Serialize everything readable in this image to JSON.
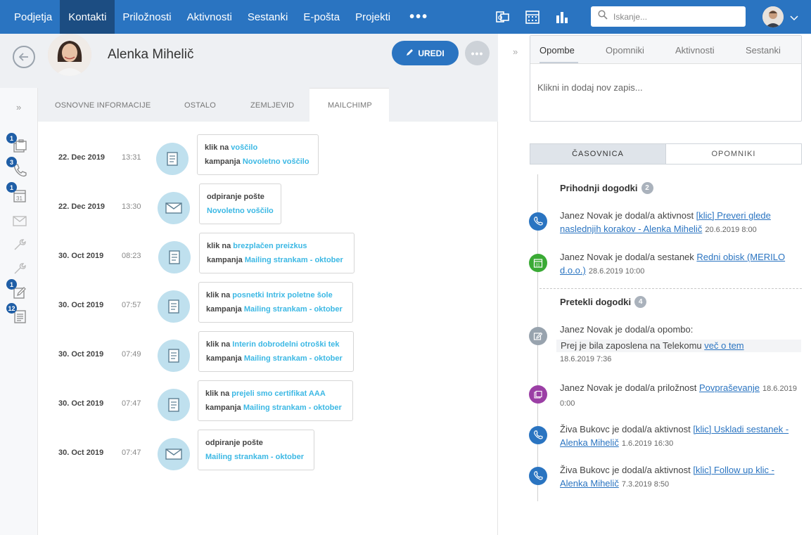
{
  "nav": {
    "items": [
      "Podjetja",
      "Kontakti",
      "Priložnosti",
      "Aktivnosti",
      "Sestanki",
      "E-pošta",
      "Projekti"
    ],
    "more": "•••",
    "search_placeholder": "Iskanje..."
  },
  "contact": {
    "name": "Alenka Mihelič",
    "edit_label": "UREDI",
    "more": "•••"
  },
  "tabs": [
    "OSNOVNE INFORMACIJE",
    "OSTALO",
    "ZEMLJEVID",
    "MAILCHIMP"
  ],
  "rail_badges": [
    "1",
    "3",
    "1",
    "1",
    "12"
  ],
  "activities": [
    {
      "date": "22. Dec 2019",
      "time": "13:31",
      "icon": "document-icon",
      "line1_label": "klik na",
      "line1_link": "voščilo",
      "line2_label": "kampanja",
      "line2_link": "Novoletno voščilo"
    },
    {
      "date": "22. Dec 2019",
      "time": "13:30",
      "icon": "envelope-icon",
      "line1_label": "odpiranje pošte",
      "line1_link": "",
      "line2_label": "",
      "line2_link": "Novoletno voščilo"
    },
    {
      "date": "30. Oct 2019",
      "time": "08:23",
      "icon": "document-icon",
      "line1_label": "klik na",
      "line1_link": "brezplačen preizkus",
      "line2_label": "kampanja",
      "line2_link": "Mailing strankam - oktober"
    },
    {
      "date": "30. Oct 2019",
      "time": "07:57",
      "icon": "document-icon",
      "line1_label": "klik na",
      "line1_link": "posnetki Intrix poletne šole",
      "line2_label": "kampanja",
      "line2_link": "Mailing strankam - oktober"
    },
    {
      "date": "30. Oct 2019",
      "time": "07:49",
      "icon": "document-icon",
      "line1_label": "klik na",
      "line1_link": "Interin dobrodelni otroški tek",
      "line2_label": "kampanja",
      "line2_link": "Mailing strankam - oktober"
    },
    {
      "date": "30. Oct 2019",
      "time": "07:47",
      "icon": "document-icon",
      "line1_label": "klik na",
      "line1_link": "prejeli smo certifikat AAA",
      "line2_label": "kampanja",
      "line2_link": "Mailing strankam - oktober"
    },
    {
      "date": "30. Oct 2019",
      "time": "07:47",
      "icon": "envelope-icon",
      "line1_label": "odpiranje pošte",
      "line1_link": "",
      "line2_label": "",
      "line2_link": "Mailing strankam - oktober"
    }
  ],
  "notes": {
    "tabs": [
      "Opombe",
      "Opomniki",
      "Aktivnosti",
      "Sestanki"
    ],
    "placeholder": "Klikni in dodaj nov zapis..."
  },
  "segments": [
    "ČASOVNICA",
    "OPOMNIKI"
  ],
  "timeline": {
    "upcoming_title": "Prihodnji dogodki",
    "upcoming_count": "2",
    "past_title": "Pretekli dogodki",
    "past_count": "4",
    "events": [
      {
        "icon": "phone-icon",
        "color": "#2a74c1",
        "prefix": "Janez Novak je dodal/a aktivnost ",
        "link": "[klic] Preveri glede naslednjih korakov - Alenka Mihelič",
        "date": "20.6.2019 8:00"
      },
      {
        "icon": "calendar-icon",
        "color": "#3aaa35",
        "prefix": "Janez Novak je dodal/a sestanek ",
        "link": "Redni obisk (MERILO d.o.o.)",
        "date": "28.6.2019 10:00"
      },
      {
        "icon": "pencil-icon",
        "color": "#98a3ae",
        "prefix": "Janez Novak je dodal/a opombo:",
        "link": "",
        "date": "18.6.2019 7:36",
        "quote": "Prej je bila zaposlena na Telekomu ",
        "quote_link": "več o tem"
      },
      {
        "icon": "briefcase-icon",
        "color": "#9b3fa5",
        "prefix": "Janez Novak je dodal/a priložnost ",
        "link": "Povpraševanje",
        "date": "18.6.2019 0:00"
      },
      {
        "icon": "phone-icon",
        "color": "#2a74c1",
        "prefix": "Živa Bukovc je dodal/a aktivnost ",
        "link": "[klic] Uskladi sestanek - Alenka Mihelič",
        "date": "1.6.2019 16:30"
      },
      {
        "icon": "phone-icon",
        "color": "#2a74c1",
        "prefix": "Živa Bukovc je dodal/a aktivnost ",
        "link": "[klic] Follow up klic - Alenka Mihelič",
        "date": "7.3.2019 8:50"
      }
    ]
  }
}
